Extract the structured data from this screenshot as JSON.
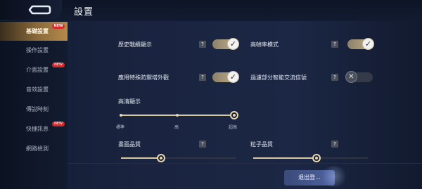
{
  "header": {
    "title": "設置"
  },
  "sidebar": {
    "items": [
      {
        "label": "基礎設置",
        "active": true,
        "badge": "NEW"
      },
      {
        "label": "操作設置",
        "active": false,
        "badge": ""
      },
      {
        "label": "介面設置",
        "active": false,
        "badge": "NEW"
      },
      {
        "label": "音效設置",
        "active": false,
        "badge": ""
      },
      {
        "label": "傳說時刻",
        "active": false,
        "badge": ""
      },
      {
        "label": "快捷訊息",
        "active": false,
        "badge": "NEW"
      },
      {
        "label": "網路檢測",
        "active": false,
        "badge": ""
      }
    ]
  },
  "settings": {
    "history_record": {
      "label": "歷史戰績顯示",
      "help": "?",
      "on": true
    },
    "high_fps": {
      "label": "高幀率模式",
      "help": "?",
      "on": true
    },
    "tower_skin": {
      "label": "應用特殊防禦塔外觀",
      "help": "?",
      "on": true
    },
    "chat_filter": {
      "label": "過濾部分智能交流信號",
      "help": "?",
      "on": false
    },
    "hd_display": {
      "label": "高清顯示",
      "options": [
        "標準",
        "高",
        "超高"
      ],
      "selected": "超高",
      "value": 1.0
    },
    "graphics_quality": {
      "label": "畫面品質",
      "help": "?",
      "value": 0.35
    },
    "particle_quality": {
      "label": "粒子品質",
      "help": "?",
      "value": 0.55
    }
  },
  "footer": {
    "logout_label": "退出登..."
  },
  "colors": {
    "accent": "#c0b08a",
    "active_tab": "#8a6a3a",
    "badge": "#d42a2a",
    "button": "#4f63a0"
  },
  "icons": {
    "back": "back-arrow-icon",
    "check": "check-icon",
    "cross": "cross-icon"
  }
}
